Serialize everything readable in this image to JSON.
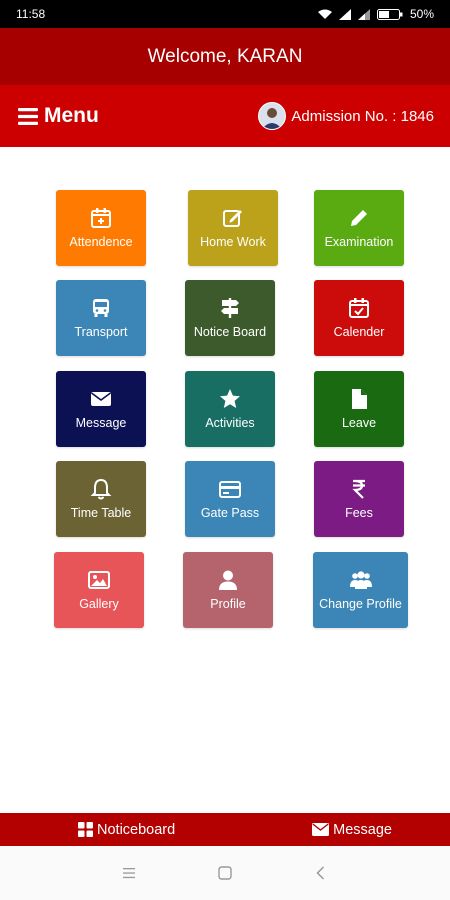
{
  "status": {
    "time": "11:58",
    "battery": "50%"
  },
  "header": {
    "welcome": "Welcome, KARAN"
  },
  "menubar": {
    "menu_label": "Menu",
    "admission": "Admission No. : 1846"
  },
  "tiles": [
    {
      "label": "Attendence",
      "color": "#ff7a00",
      "icon": "calendar-plus-icon"
    },
    {
      "label": "Home Work",
      "color": "#bba21a",
      "icon": "edit-icon"
    },
    {
      "label": "Examination",
      "color": "#5aaa12",
      "icon": "pencil-icon"
    },
    {
      "label": "Transport",
      "color": "#3b86b6",
      "icon": "bus-icon"
    },
    {
      "label": "Notice Board",
      "color": "#3c5a2c",
      "icon": "signpost-icon"
    },
    {
      "label": "Calender",
      "color": "#cc0b0b",
      "icon": "calendar-check-icon"
    },
    {
      "label": "Message",
      "color": "#0b1153",
      "icon": "envelope-icon"
    },
    {
      "label": "Activities",
      "color": "#186e63",
      "icon": "star-icon"
    },
    {
      "label": "Leave",
      "color": "#1a6a12",
      "icon": "file-icon"
    },
    {
      "label": "Time Table",
      "color": "#6b6333",
      "icon": "bell-icon"
    },
    {
      "label": "Gate Pass",
      "color": "#3b86b6",
      "icon": "credit-card-icon"
    },
    {
      "label": "Fees",
      "color": "#7b1b83",
      "icon": "rupee-icon"
    },
    {
      "label": "Gallery",
      "color": "#e85558",
      "icon": "image-icon"
    },
    {
      "label": "Profile",
      "color": "#b5636c",
      "icon": "user-icon"
    },
    {
      "label": "Change Profile",
      "color": "#3b86b6",
      "icon": "users-icon"
    }
  ],
  "bottombar": {
    "noticeboard": "Noticeboard",
    "message": "Message"
  }
}
